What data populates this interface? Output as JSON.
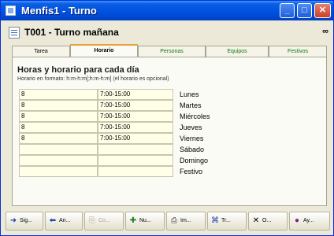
{
  "window": {
    "title": "Menfis1 - Turno"
  },
  "header": {
    "title": "T001 - Turno mañana"
  },
  "tabs": [
    {
      "label": "Tarea"
    },
    {
      "label": "Horario"
    },
    {
      "label": "Personas"
    },
    {
      "label": "Equipos"
    },
    {
      "label": "Festivos"
    }
  ],
  "section": {
    "heading": "Horas y horario para cada día",
    "hint": "Horario en formato: h:m-h:m[;h:m-h:m] (el horario es opcional)"
  },
  "schedule": [
    {
      "hours": "8",
      "time": "7:00-15:00",
      "day": "Lunes"
    },
    {
      "hours": "8",
      "time": "7:00-15:00",
      "day": "Martes"
    },
    {
      "hours": "8",
      "time": "7:00-15:00",
      "day": "Miércoles"
    },
    {
      "hours": "8",
      "time": "7:00-15:00",
      "day": "Jueves"
    },
    {
      "hours": "8",
      "time": "7:00-15:00",
      "day": "Viernes"
    },
    {
      "hours": "",
      "time": "",
      "day": "Sábado"
    },
    {
      "hours": "",
      "time": "",
      "day": "Domingo"
    },
    {
      "hours": "",
      "time": "",
      "day": "Festivo"
    }
  ],
  "toolbar": [
    {
      "icon": "arrow-right-icon",
      "glyph": "➜",
      "label": "Sig..."
    },
    {
      "icon": "arrow-left-icon",
      "glyph": "⬅",
      "label": "An..."
    },
    {
      "icon": "copy-icon",
      "glyph": "⎘",
      "label": "Co..."
    },
    {
      "icon": "new-icon",
      "glyph": "✚",
      "label": "Nu..."
    },
    {
      "icon": "print-icon",
      "glyph": "⎙",
      "label": "Im..."
    },
    {
      "icon": "tree-icon",
      "glyph": "⌘",
      "label": "Tr..."
    },
    {
      "icon": "delete-icon",
      "glyph": "✕",
      "label": "O..."
    },
    {
      "icon": "help-icon",
      "glyph": "●",
      "label": "Ay..."
    }
  ]
}
